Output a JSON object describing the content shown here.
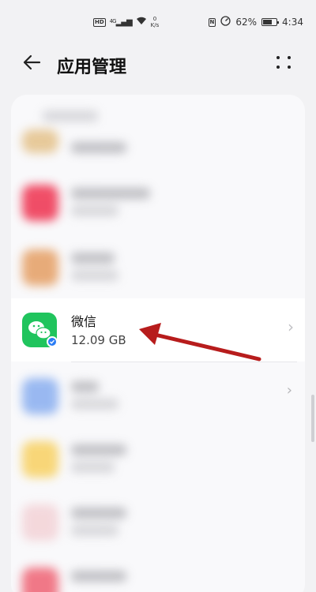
{
  "status_bar": {
    "hd": "HD",
    "signal": "4G",
    "speed_value": "0",
    "speed_unit": "K/s",
    "nfc": "N",
    "battery": "62%",
    "time": "4:34"
  },
  "header": {
    "title": "应用管理"
  },
  "apps": [
    {
      "name": "微信",
      "size": "12.09 GB"
    }
  ],
  "colors": {
    "wechat_green": "#20c45d",
    "arrow_red": "#b71c1c",
    "badge_blue": "#2a7cf5"
  }
}
